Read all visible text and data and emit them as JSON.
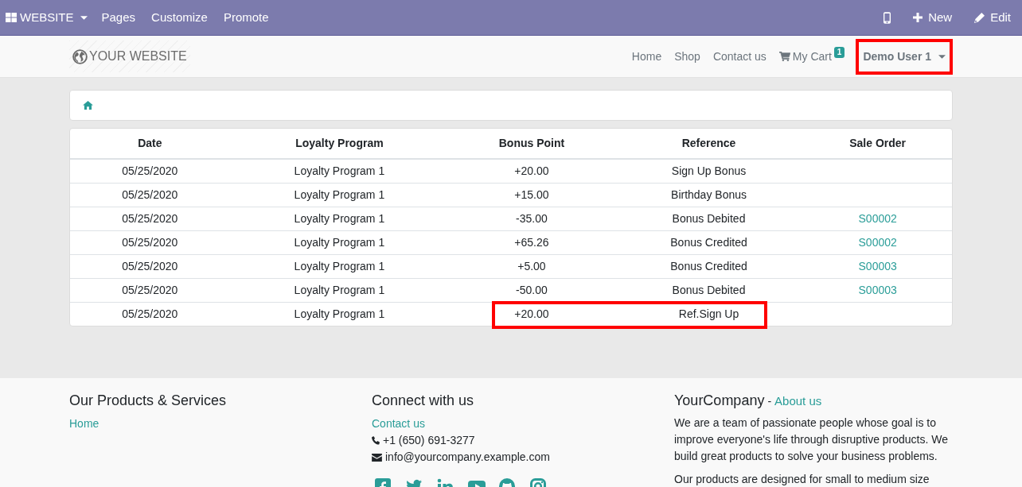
{
  "admin_bar": {
    "app_menu": "WEBSITE",
    "menus": [
      "Pages",
      "Customize",
      "Promote"
    ],
    "actions": [
      {
        "kind": "mobile"
      },
      {
        "kind": "new",
        "label": "New"
      },
      {
        "kind": "edit",
        "label": "Edit"
      }
    ]
  },
  "header": {
    "logo": "YOUR WEBSITE",
    "nav": [
      {
        "kind": "link",
        "label": "Home"
      },
      {
        "kind": "link",
        "label": "Shop"
      },
      {
        "kind": "link",
        "label": "Contact us"
      },
      {
        "kind": "cart",
        "label": "My Cart",
        "badge": "1"
      }
    ],
    "user_menu": {
      "label": "Demo User 1",
      "highlighted": true
    }
  },
  "table": {
    "columns": [
      "Date",
      "Loyalty Program",
      "Bonus Point",
      "Reference",
      "Sale Order"
    ],
    "rows": [
      {
        "cells": [
          "05/25/2020",
          "Loyalty Program 1",
          "+20.00",
          "Sign Up Bonus"
        ],
        "highlighted": false
      },
      {
        "cells": [
          "05/25/2020",
          "Loyalty Program 1",
          "+15.00",
          "Birthday Bonus"
        ],
        "highlighted": false
      },
      {
        "cells": [
          "05/25/2020",
          "Loyalty Program 1",
          "-35.00",
          "Bonus Debited",
          "S00002"
        ],
        "highlighted": false
      },
      {
        "cells": [
          "05/25/2020",
          "Loyalty Program 1",
          "+65.26",
          "Bonus Credited",
          "S00002"
        ],
        "highlighted": false
      },
      {
        "cells": [
          "05/25/2020",
          "Loyalty Program 1",
          "+5.00",
          "Bonus Credited",
          "S00003"
        ],
        "highlighted": false
      },
      {
        "cells": [
          "05/25/2020",
          "Loyalty Program 1",
          "-50.00",
          "Bonus Debited",
          "S00003"
        ],
        "highlighted": false
      },
      {
        "cells": [
          "05/25/2020",
          "Loyalty Program 1",
          "+20.00",
          "Ref.Sign Up"
        ],
        "highlighted": true
      }
    ]
  },
  "footer": {
    "products": {
      "title": "Our Products & Services",
      "links": [
        "Home"
      ]
    },
    "connect": {
      "title": "Connect with us",
      "link": "Contact us",
      "phone": "+1 (650) 691-3277",
      "email": "info@yourcompany.example.com"
    },
    "company": {
      "title": "YourCompany",
      "separator": "-",
      "link": "About us",
      "paragraphs": [
        "We are a team of passionate people whose goal is to improve everyone's life through disruptive products. We build great products to solve your business problems.",
        "Our products are designed for small to medium size"
      ]
    }
  }
}
